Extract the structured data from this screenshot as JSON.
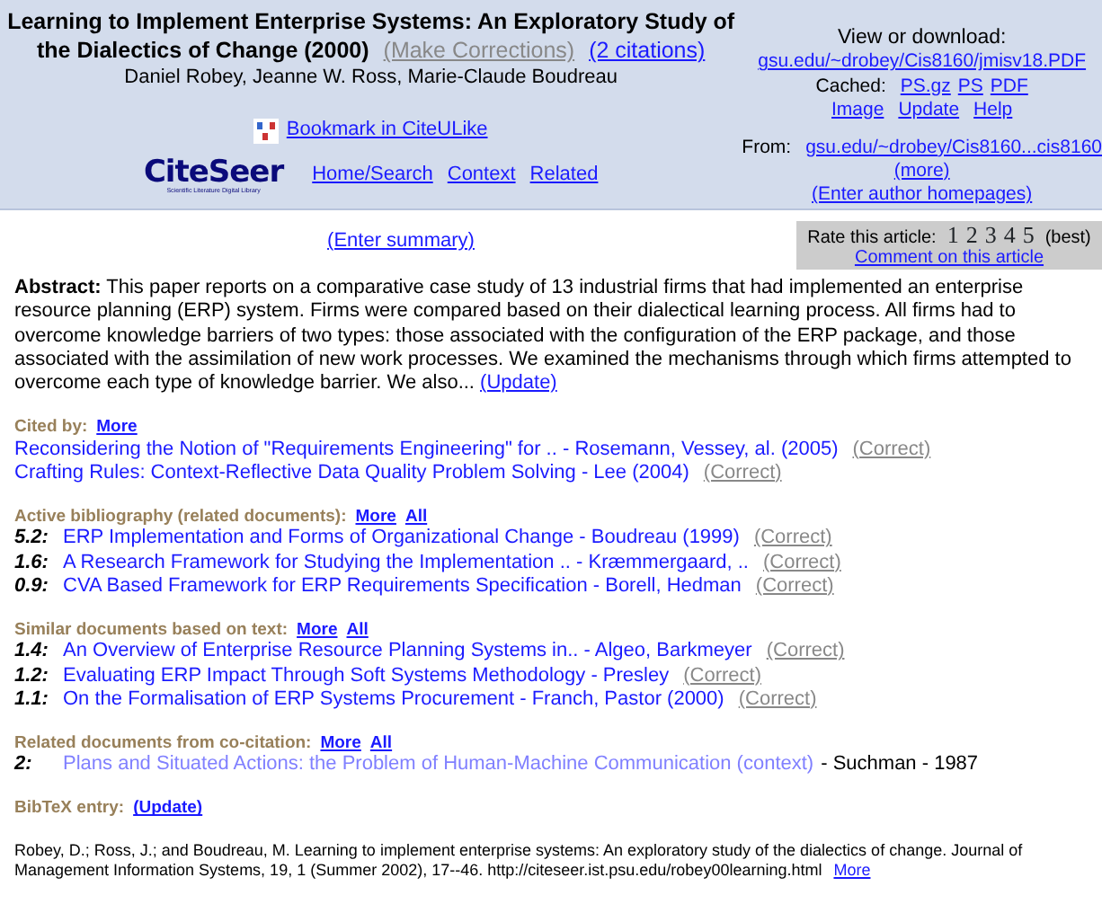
{
  "header": {
    "title_lines": [
      "Learning to Implement Enterprise Systems: An Exploratory Study of",
      "the Dialectics of Change (2000)"
    ],
    "make_corrections": "(Make Corrections)",
    "citations": "(2 citations)",
    "authors": "Daniel Robey, Jeanne W. Ross, Marie-Claude Boudreau",
    "bookmark": "Bookmark in CiteULike",
    "logo": {
      "name": "CiteSeer",
      "tagline": "Scientific Literature Digital Library"
    },
    "nav": [
      "Home/Search",
      "Context",
      "Related"
    ]
  },
  "download": {
    "heading": "View or download:",
    "url": "gsu.edu/~drobey/Cis8160/jmisv18.PDF",
    "cached_label": "Cached:",
    "cached": [
      "PS.gz",
      "PS",
      "PDF"
    ],
    "actions": [
      "Image",
      "Update",
      "Help"
    ],
    "from_label": "From:",
    "from_url": "gsu.edu/~drobey/Cis8160...cis8160",
    "more": "(more)",
    "homepages": "(Enter author homepages)"
  },
  "summary_link": "(Enter summary)",
  "rating": {
    "label": "Rate this article:",
    "values": [
      "1",
      "2",
      "3",
      "4",
      "5"
    ],
    "best": "(best)",
    "comment": "Comment on this article"
  },
  "abstract": {
    "label": "Abstract:",
    "text": "This paper reports on a comparative case study of 13 industrial firms that had implemented an enterprise resource planning (ERP) system. Firms were compared based on their dialectical learning process. All firms had to overcome knowledge barriers of two types: those associated with the configuration of the ERP package, and those associated with the assimilation of new work processes. We examined the mechanisms through which firms attempted to overcome each type of knowledge barrier. We also...",
    "update": "(Update)"
  },
  "sections": [
    {
      "heading": "Cited by:",
      "links": [
        "More"
      ],
      "items": [
        {
          "title": "Reconsidering the Notion of \"Requirements Engineering\" for .. - Rosemann, Vessey, al. (2005)",
          "visited": false,
          "action": "(Correct)"
        },
        {
          "title": "Crafting Rules: Context-Reflective Data Quality Problem Solving - Lee (2004)",
          "visited": false,
          "action": "(Correct)"
        }
      ]
    },
    {
      "heading": "Active bibliography (related documents):",
      "links": [
        "More",
        "All"
      ],
      "items": [
        {
          "score": "5.2:",
          "title": "ERP Implementation and Forms of Organizational Change - Boudreau (1999)",
          "visited": false,
          "action": "(Correct)"
        },
        {
          "score": "1.6:",
          "title": "A Research Framework for Studying the Implementation .. - Kræmmergaard, ..",
          "visited": false,
          "action": "(Correct)"
        },
        {
          "score": "0.9:",
          "title": "CVA Based Framework for ERP Requirements Specification - Borell, Hedman",
          "visited": false,
          "action": "(Correct)"
        }
      ]
    },
    {
      "heading": "Similar documents based on text:",
      "links": [
        "More",
        "All"
      ],
      "items": [
        {
          "score": "1.4:",
          "title": "An Overview of Enterprise Resource Planning Systems in.. - Algeo, Barkmeyer",
          "visited": false,
          "action": "(Correct)"
        },
        {
          "score": "1.2:",
          "title": "Evaluating ERP Impact Through Soft Systems Methodology - Presley",
          "visited": false,
          "action": "(Correct)"
        },
        {
          "score": "1.1:",
          "title": "On the Formalisation of ERP Systems Procurement - Franch, Pastor (2000)",
          "visited": false,
          "action": "(Correct)"
        }
      ]
    },
    {
      "heading": "Related documents from co-citation:",
      "links": [
        "More",
        "All"
      ],
      "items": [
        {
          "score": "2:",
          "title": "Plans and Situated Actions: the Problem of Human-Machine Communication (context)",
          "visited": true,
          "suffix": "- Suchman - 1987"
        }
      ]
    },
    {
      "heading": "BibTeX entry:",
      "links": [
        "(Update)"
      ]
    }
  ],
  "reference": {
    "text": "Robey, D.; Ross, J.; and Boudreau, M. Learning to implement enterprise systems: An exploratory study of the dialectics of change. Journal of Management Information Systems, 19, 1 (Summer 2002), 17--46. http://citeseer.ist.psu.edu/robey00learning.html",
    "more": "More"
  }
}
